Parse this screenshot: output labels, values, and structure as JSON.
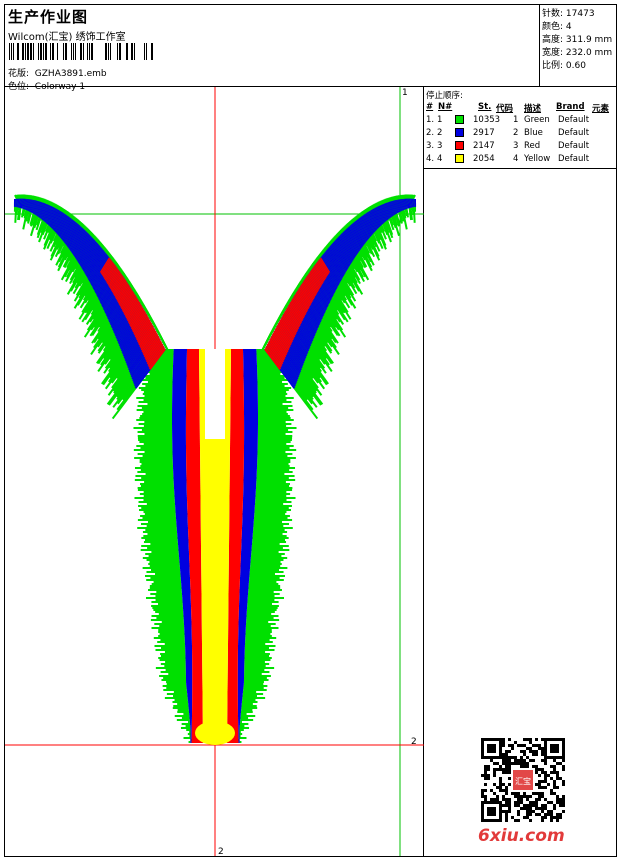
{
  "header": {
    "title": "生产作业图",
    "subtitle": "Wilcom(汇宝) 绣饰工作室",
    "design_label": "花版:",
    "design_value": "GZHA3891.emb",
    "colorway_label": "色位:",
    "colorway_value": "Colorway 1"
  },
  "stats": [
    {
      "label": "针数:",
      "value": "17473"
    },
    {
      "label": "颜色:",
      "value": "4"
    },
    {
      "label": "高度:",
      "value": "311.9 mm"
    },
    {
      "label": "宽度:",
      "value": "232.0 mm"
    },
    {
      "label": "比例:",
      "value": "0.60"
    }
  ],
  "sequence": {
    "title": "停止顺序:",
    "columns": [
      "#",
      "N#",
      "St.",
      "代码",
      "描述",
      "Brand",
      "元素"
    ],
    "rows": [
      {
        "idx": "1.",
        "n": "1",
        "st": "10353",
        "code": "1",
        "desc": "Green",
        "brand": "Default",
        "color": "#00e000"
      },
      {
        "idx": "2.",
        "n": "2",
        "st": "2917",
        "code": "2",
        "desc": "Blue",
        "brand": "Default",
        "color": "#0000e0"
      },
      {
        "idx": "3.",
        "n": "3",
        "st": "2147",
        "code": "3",
        "desc": "Red",
        "brand": "Default",
        "color": "#ff0000"
      },
      {
        "idx": "4.",
        "n": "4",
        "st": "2054",
        "code": "4",
        "desc": "Yellow",
        "brand": "Default",
        "color": "#ffff00"
      }
    ]
  },
  "guides": {
    "label_top": "1",
    "label_right": "2",
    "label_bottom": "2"
  },
  "watermark": "6xiu.com",
  "seal_text": "汇宝"
}
